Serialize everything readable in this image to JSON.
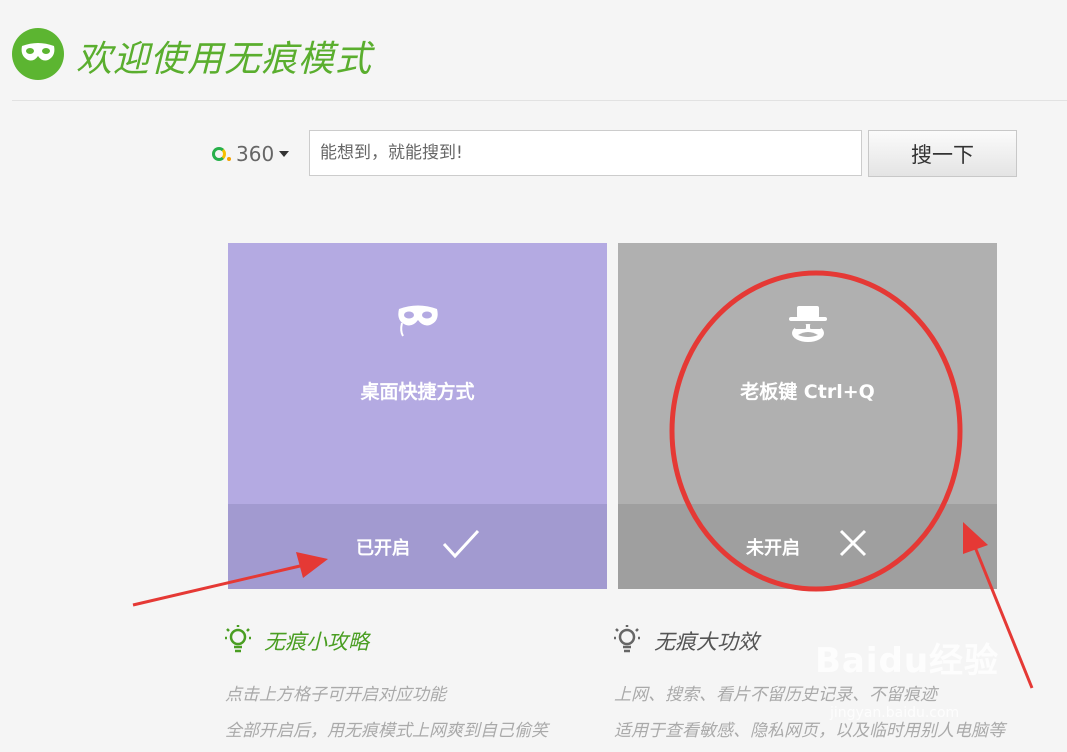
{
  "header": {
    "title": "欢迎使用无痕模式"
  },
  "search": {
    "engine_name": "360",
    "placeholder": "能想到，就能搜到!",
    "button_label": "搜一下"
  },
  "cards": [
    {
      "label": "桌面快捷方式",
      "state": "已开启",
      "enabled": true,
      "icon": "mask-icon",
      "bg": "#b4aae2",
      "bar": "#a29ad0"
    },
    {
      "label": "老板键 Ctrl+Q",
      "state": "未开启",
      "enabled": false,
      "icon": "boss-icon",
      "bg": "#b0b0b0",
      "bar": "#9f9f9f"
    }
  ],
  "tips": [
    {
      "title": "无痕小攻略",
      "color": "#4a9e22",
      "lines": [
        "点击上方格子可开启对应功能",
        "全部开启后，用无痕模式上网爽到自己偷笑"
      ]
    },
    {
      "title": "无痕大功效",
      "color": "#555555",
      "lines": [
        "上网、搜索、看片不留历史记录、不留痕迹",
        "适用于查看敏感、隐私网页，以及临时用别人电脑等"
      ]
    }
  ],
  "watermark": {
    "text": "Baidu经验",
    "sub": "jingyan.baidu.com"
  },
  "colors": {
    "brand": "#5cb531",
    "annotation": "#e53935"
  }
}
